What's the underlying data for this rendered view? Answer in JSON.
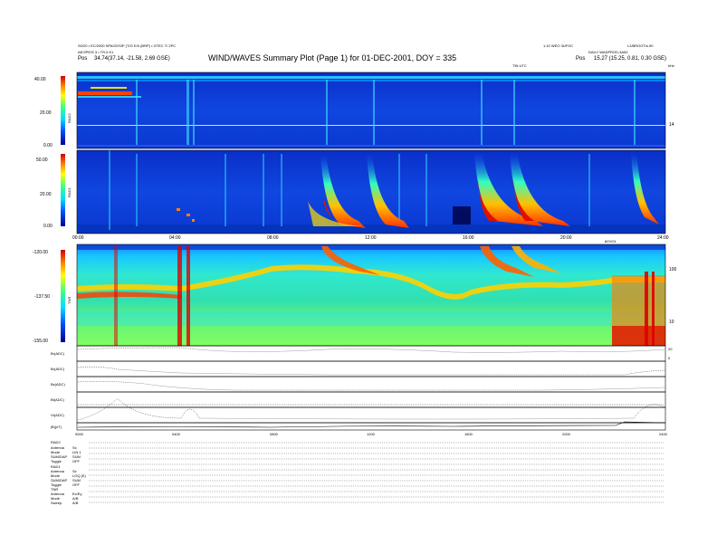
{
  "header": {
    "title": "WIND/WAVES Summary Plot (Page 1) for 01-DEC-2001, DOY = 335",
    "left_line1": "S0/20 • EC/2000 SPACE/SIP (T/2/ E/0 (BRP) • GTEC T/ 2PC",
    "left_line2": "AE/2PE/S 3 • TR.0 K1",
    "left_pos_label": "Pos",
    "left_pos_value": "34.74(37.14, -21.58, 2.69 GSE)",
    "right_line1": "1.10 WEO 3UFOC",
    "right_line1b": "L2/BROOT/s.90",
    "right_line2": "DAILY WADPROD,3A00",
    "right_pos_label": "Pos",
    "right_pos_value": "15.27 (15.25, 0.81, 0.30 GSE)",
    "time_tag": "TIN UTC",
    "khz_tag": "kHz"
  },
  "chart_data": [
    {
      "type": "heatmap",
      "name": "RAD2",
      "ylabel": "RAD2",
      "y_ticks": [
        "40.00",
        "20.00",
        "0.00"
      ],
      "right_ticks": [
        "14"
      ],
      "colorbar": "rainbow"
    },
    {
      "type": "heatmap",
      "name": "RAD1",
      "ylabel": "RAD1",
      "y_ticks": [
        "50.00",
        "20.00",
        "0.00"
      ],
      "x_ticks": [
        "00:00",
        "04:00",
        "08:00",
        "12:00",
        "16:00",
        "20:00",
        "24:00"
      ],
      "colorbar": "rainbow"
    },
    {
      "type": "heatmap",
      "name": "TNR",
      "ylabel": "TNR",
      "y_ticks": [
        "-120.00",
        "-137.50",
        "-155.00"
      ],
      "right_ticks": [
        "100",
        "10"
      ],
      "top_right_label": "8/IV/01",
      "colorbar": "rainbow"
    },
    {
      "type": "line",
      "name": "housekeeping",
      "panels": [
        "Br(ADC)",
        "Br(ADC)",
        "Bz(ADC)",
        "Bt(ADC)",
        "Vt(ADC)",
        "|B|(nT)"
      ],
      "right_ticks": [
        "20",
        "0"
      ],
      "x_ticks": [
        "0000",
        "0400",
        "0800",
        "1200",
        "1600",
        "2000",
        "2400"
      ]
    }
  ],
  "footer": {
    "rad2_block": [
      {
        "label": "RAD2",
        "value": ""
      },
      {
        "label": "Antenna",
        "value": "Sx"
      },
      {
        "label": "Mode",
        "value": "LIN 1"
      },
      {
        "label": "SUM/DAP",
        "value": "SUM"
      },
      {
        "label": "Toggle",
        "value": "OFF"
      }
    ],
    "rad1_block": [
      {
        "label": "RAD1",
        "value": ""
      },
      {
        "label": "Antenna",
        "value": "Sx"
      },
      {
        "label": "Mode",
        "value": "LOQ (E)"
      },
      {
        "label": "SUM/DAP",
        "value": "SUM"
      },
      {
        "label": "Toggle",
        "value": "OFF"
      }
    ],
    "tnr_block": [
      {
        "label": "TNR",
        "value": ""
      },
      {
        "label": "Antenna",
        "value": "Ex/Ey"
      },
      {
        "label": "Mode",
        "value": "A/B"
      },
      {
        "label": "Sweep",
        "value": "A/B"
      }
    ]
  }
}
